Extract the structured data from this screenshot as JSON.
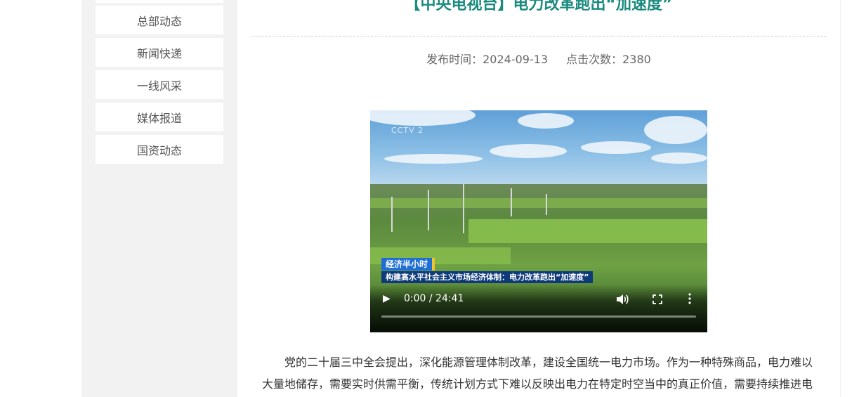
{
  "sidebar": {
    "items": [
      {
        "label": "总部动态"
      },
      {
        "label": "新闻快递"
      },
      {
        "label": "一线风采"
      },
      {
        "label": "媒体报道"
      },
      {
        "label": "国资动态"
      }
    ]
  },
  "article": {
    "title": "【中央电视台】电力改革跑出“加速度”",
    "publish_label": "发布时间：2024-09-13",
    "views_label": "点击次数：2380",
    "body": "党的二十届三中全会提出，深化能源管理体制改革，建设全国统一电力市场。作为一种特殊商品，电力难以大量地储存，需要实时供需平衡，传统计划方式下难以反映出电力在特定时空当中的真正价值，需要持续推进电"
  },
  "video": {
    "watermark": "CCTV 2",
    "caption_tag": "经济半小时",
    "caption_text": "构建高水平社会主义市场经济体制：电力改革跑出“加速度”",
    "time": "0:00 / 24:41",
    "progress": 0,
    "icons": [
      "play-icon",
      "volume-icon",
      "fullscreen-icon",
      "more-options-icon"
    ]
  },
  "colors": {
    "title": "#1a8a7e",
    "page_bg": "#f2f2f2",
    "caption_blue": "#1f6ed4"
  }
}
